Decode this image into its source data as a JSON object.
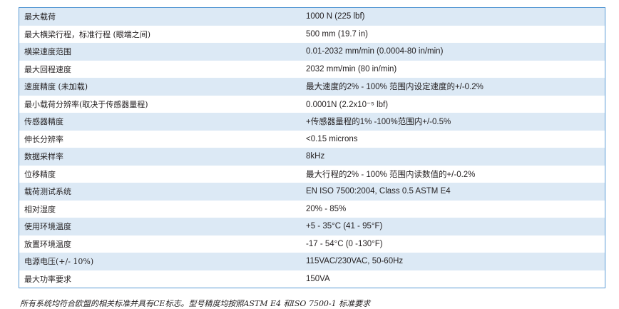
{
  "spec_table": {
    "rows": [
      {
        "param": "最大载荷",
        "value": "1000 N (225 lbf)"
      },
      {
        "param": "最大横梁行程，标准行程 (眼端之间)",
        "value": "500 mm (19.7 in)"
      },
      {
        "param": "横梁速度范围",
        "value": "0.01-2032 mm/min (0.0004-80 in/min)"
      },
      {
        "param": "最大回程速度",
        "value": "2032 mm/min (80 in/min)"
      },
      {
        "param": "速度精度 (未加载)",
        "value": "最大速度的2% - 100% 范围内设定速度的+/-0.2%"
      },
      {
        "param": "最小载荷分辨率(取决于传感器量程)",
        "value": "0.0001N (2.2x10⁻⁵ lbf)"
      },
      {
        "param": "传感器精度",
        "value": "+传感器量程的1% -100%范围内+/-0.5%"
      },
      {
        "param": "伸长分辨率",
        "value": "<0.15 microns"
      },
      {
        "param": "数据采样率",
        "value": "8kHz"
      },
      {
        "param": "位移精度",
        "value": "最大行程的2% - 100% 范围内读数值的+/-0.2%"
      },
      {
        "param": "载荷测试系统",
        "value": "EN ISO 7500:2004, Class 0.5 ASTM E4"
      },
      {
        "param": "相对湿度",
        "value": "20% - 85%"
      },
      {
        "param": "使用环境温度",
        "value": "+5 - 35°C (41 - 95°F)"
      },
      {
        "param": "放置环境温度",
        "value": "-17 - 54°C (0 -130°F)"
      },
      {
        "param": "电源电压(+/- 10%)",
        "value": "115VAC/230VAC, 50-60Hz"
      },
      {
        "param": "最大功率要求",
        "value": "150VA"
      }
    ]
  },
  "footnote": "所有系统均符合欧盟的相关标准并具有CE标志。型号精度均按照ASTM E4 和ISO 7500-1 标准要求"
}
